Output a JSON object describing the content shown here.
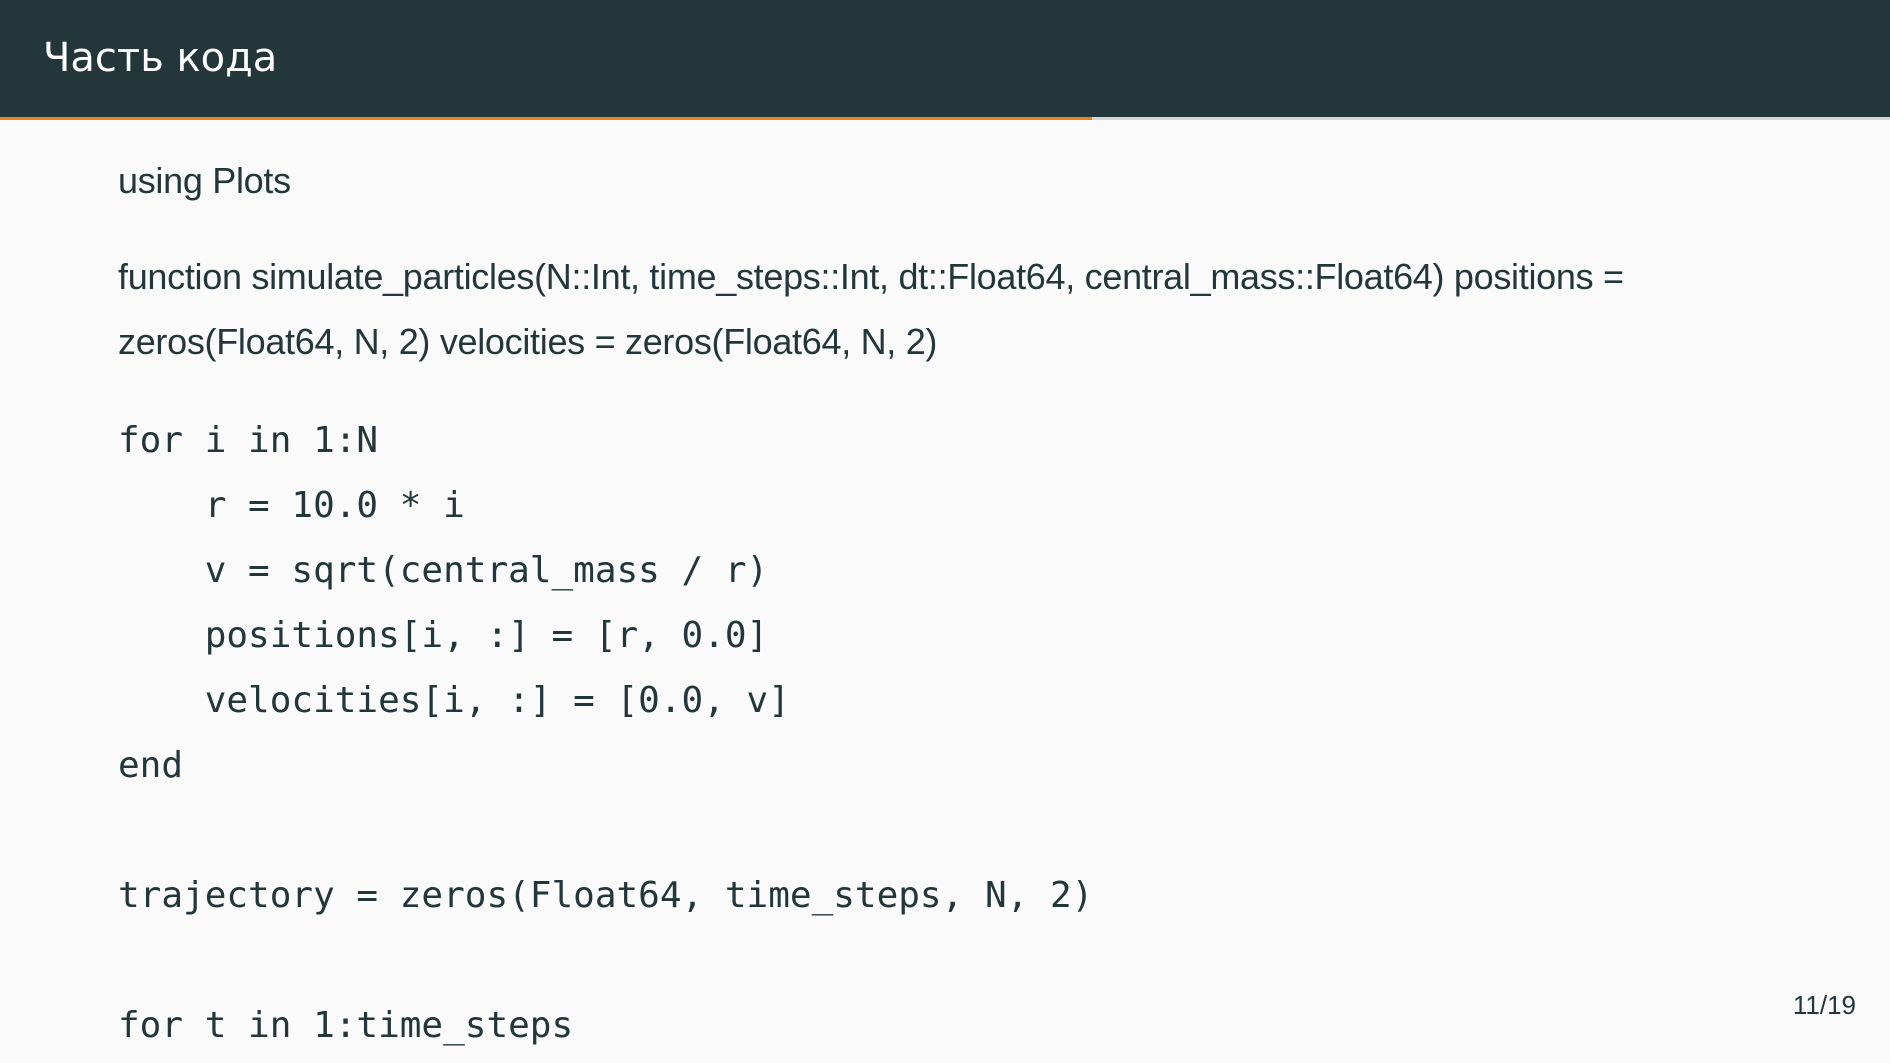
{
  "slide": {
    "title": "Часть кода",
    "progress": 0.578,
    "page_number": "11/19"
  },
  "content": {
    "using_line": "using Plots",
    "function_line_1": "function simulate_particles(N::Int, time_steps::Int, dt::Float64, central_mass::Float64) positions =",
    "function_line_2": "zeros(Float64, N, 2) velocities = zeros(Float64, N, 2)",
    "code_lines": [
      "for i in 1:N",
      "    r = 10.0 * i",
      "    v = sqrt(central_mass / r)",
      "    positions[i, :] = [r, 0.0]",
      "    velocities[i, :] = [0.0, v]",
      "end",
      "",
      "trajectory = zeros(Float64, time_steps, N, 2)",
      "",
      "for t in 1:time_steps"
    ]
  },
  "colors": {
    "header_bg": "#23373b",
    "accent": "#eb811b",
    "background": "#fafafa",
    "text": "#23373b"
  }
}
